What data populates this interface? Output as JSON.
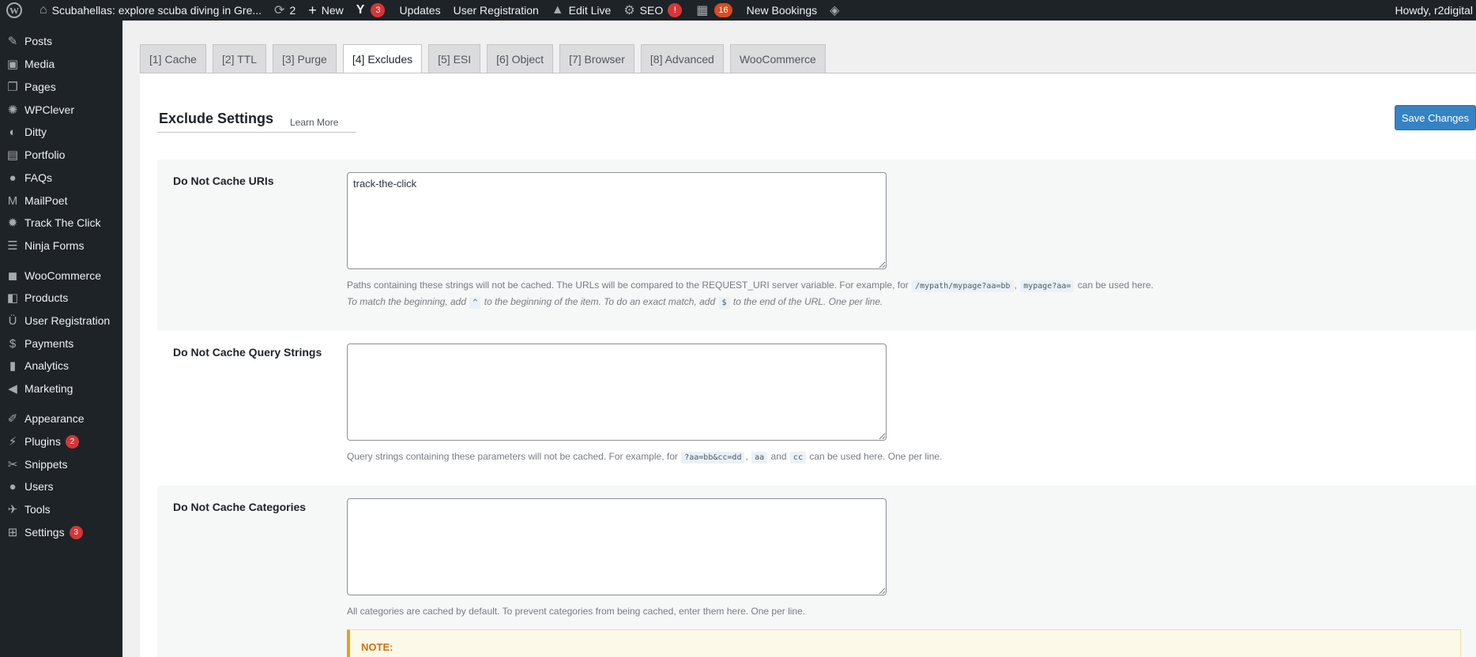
{
  "adminbar": {
    "site_title": "Scubahellas: explore scuba diving in Gre...",
    "updates_count": "2",
    "new_label": "New",
    "yoast_count": "3",
    "updates_label": "Updates",
    "user_registration_label": "User Registration",
    "edit_live_label": "Edit Live",
    "seo_label": "SEO",
    "seo_alert": "!",
    "bookings_count": "16",
    "new_bookings_label": "New Bookings",
    "howdy": "Howdy, r2digital"
  },
  "sidebar": {
    "items": [
      {
        "label": "Posts",
        "icon": "pushpin-icon"
      },
      {
        "label": "Media",
        "icon": "media-icon"
      },
      {
        "label": "Pages",
        "icon": "pages-icon"
      },
      {
        "label": "WPClever",
        "icon": "lightbulb-icon"
      },
      {
        "label": "Ditty",
        "icon": "ditty-icon"
      },
      {
        "label": "Portfolio",
        "icon": "portfolio-icon"
      },
      {
        "label": "FAQs",
        "icon": "info-icon"
      },
      {
        "label": "MailPoet",
        "icon": "mailpoet-icon"
      },
      {
        "label": "Track The Click",
        "icon": "gear-icon"
      },
      {
        "label": "Ninja Forms",
        "icon": "forms-icon"
      },
      {
        "label": "WooCommerce",
        "icon": "woo-icon"
      },
      {
        "label": "Products",
        "icon": "bag-icon"
      },
      {
        "label": "User Registration",
        "icon": "ur-icon"
      },
      {
        "label": "Payments",
        "icon": "dollar-icon"
      },
      {
        "label": "Analytics",
        "icon": "chart-icon"
      },
      {
        "label": "Marketing",
        "icon": "megaphone-icon"
      },
      {
        "label": "Appearance",
        "icon": "brush-icon"
      },
      {
        "label": "Plugins",
        "icon": "plug-icon",
        "badge": "2"
      },
      {
        "label": "Snippets",
        "icon": "scissors-icon"
      },
      {
        "label": "Users",
        "icon": "user-icon"
      },
      {
        "label": "Tools",
        "icon": "wrench-icon"
      },
      {
        "label": "Settings",
        "icon": "settings-icon",
        "badge": "3"
      }
    ]
  },
  "tabs": [
    "[1] Cache",
    "[2] TTL",
    "[3] Purge",
    "[4] Excludes",
    "[5] ESI",
    "[6] Object",
    "[7] Browser",
    "[8] Advanced",
    "WooCommerce"
  ],
  "active_tab": "[4] Excludes",
  "section": {
    "title": "Exclude Settings",
    "learn_more": "Learn More",
    "save_label": "Save Changes"
  },
  "uris": {
    "label": "Do Not Cache URIs",
    "value": "track-the-click",
    "desc1_a": "Paths containing these strings will not be cached. The URLs will be compared to the REQUEST_URI server variable. For example, for",
    "code1": "/mypath/mypage?aa=bb",
    "sep1": ",",
    "code2": "mypage?aa=",
    "desc1_b": "can be used here.",
    "desc2_a": "To match the beginning, add",
    "code3": "^",
    "desc2_b": "to the beginning of the item. To do an exact match, add",
    "code4": "$",
    "desc2_c": "to the end of the URL. One per line."
  },
  "query": {
    "label": "Do Not Cache Query Strings",
    "value": "",
    "desc_a": "Query strings containing these parameters will not be cached. For example, for",
    "code1": "?aa=bb&cc=dd",
    "sep1": ",",
    "code2": "aa",
    "and": "and",
    "code3": "cc",
    "desc_b": "can be used here. One per line."
  },
  "categories": {
    "label": "Do Not Cache Categories",
    "value": "",
    "desc": "All categories are cached by default. To prevent categories from being cached, enter them here. One per line."
  },
  "note": {
    "title": "NOTE:"
  }
}
